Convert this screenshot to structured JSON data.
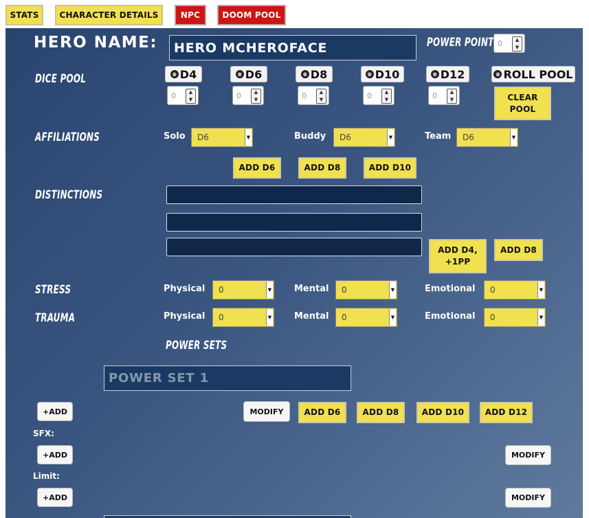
{
  "tabs": [
    "STATS",
    "CHARACTER DETAILS",
    "NPC",
    "DOOM POOL"
  ],
  "hero": {
    "label": "HERO NAME:",
    "name": "HERO MCHEROFACE"
  },
  "power_points": {
    "label": "POWER POINTS",
    "value": "0"
  },
  "dice_pool": {
    "label": "DICE POOL",
    "dice": [
      "D4",
      "D6",
      "D8",
      "D10",
      "D12"
    ],
    "values": [
      "0",
      "0",
      "0",
      "0",
      "0"
    ],
    "roll_label": "ROLL POOL",
    "clear_label": "CLEAR POOL"
  },
  "affiliations": {
    "label": "AFFILIATIONS",
    "items": [
      {
        "label": "Solo",
        "value": "D6"
      },
      {
        "label": "Buddy",
        "value": "D6"
      },
      {
        "label": "Team",
        "value": "D6"
      }
    ],
    "buttons": [
      "ADD D6",
      "ADD D8",
      "ADD D10"
    ]
  },
  "distinctions": {
    "label": "DISTINCTIONS",
    "values": [
      "",
      "",
      ""
    ],
    "add_d4_label": "ADD D4, +1PP",
    "add_d8_label": "ADD D8"
  },
  "stress": {
    "label": "STRESS",
    "items": [
      {
        "label": "Physical",
        "value": "0"
      },
      {
        "label": "Mental",
        "value": "0"
      },
      {
        "label": "Emotional",
        "value": "0"
      }
    ]
  },
  "trauma": {
    "label": "TRAUMA",
    "items": [
      {
        "label": "Physical",
        "value": "0"
      },
      {
        "label": "Mental",
        "value": "0"
      },
      {
        "label": "Emotional",
        "value": "0"
      }
    ]
  },
  "power_sets": {
    "label": "POWER SETS",
    "set1_placeholder": "POWER SET 1",
    "add_label": "+ADD",
    "modify_label": "MODIFY",
    "die_buttons": [
      "ADD D6",
      "ADD D8",
      "ADD D10",
      "ADD D12"
    ],
    "sfx_label": "SFX:",
    "limit_label": "Limit:"
  },
  "colors": {
    "accent_yellow": "#f1e04f",
    "accent_red": "#d01313",
    "panel_blue": "#34507b"
  }
}
